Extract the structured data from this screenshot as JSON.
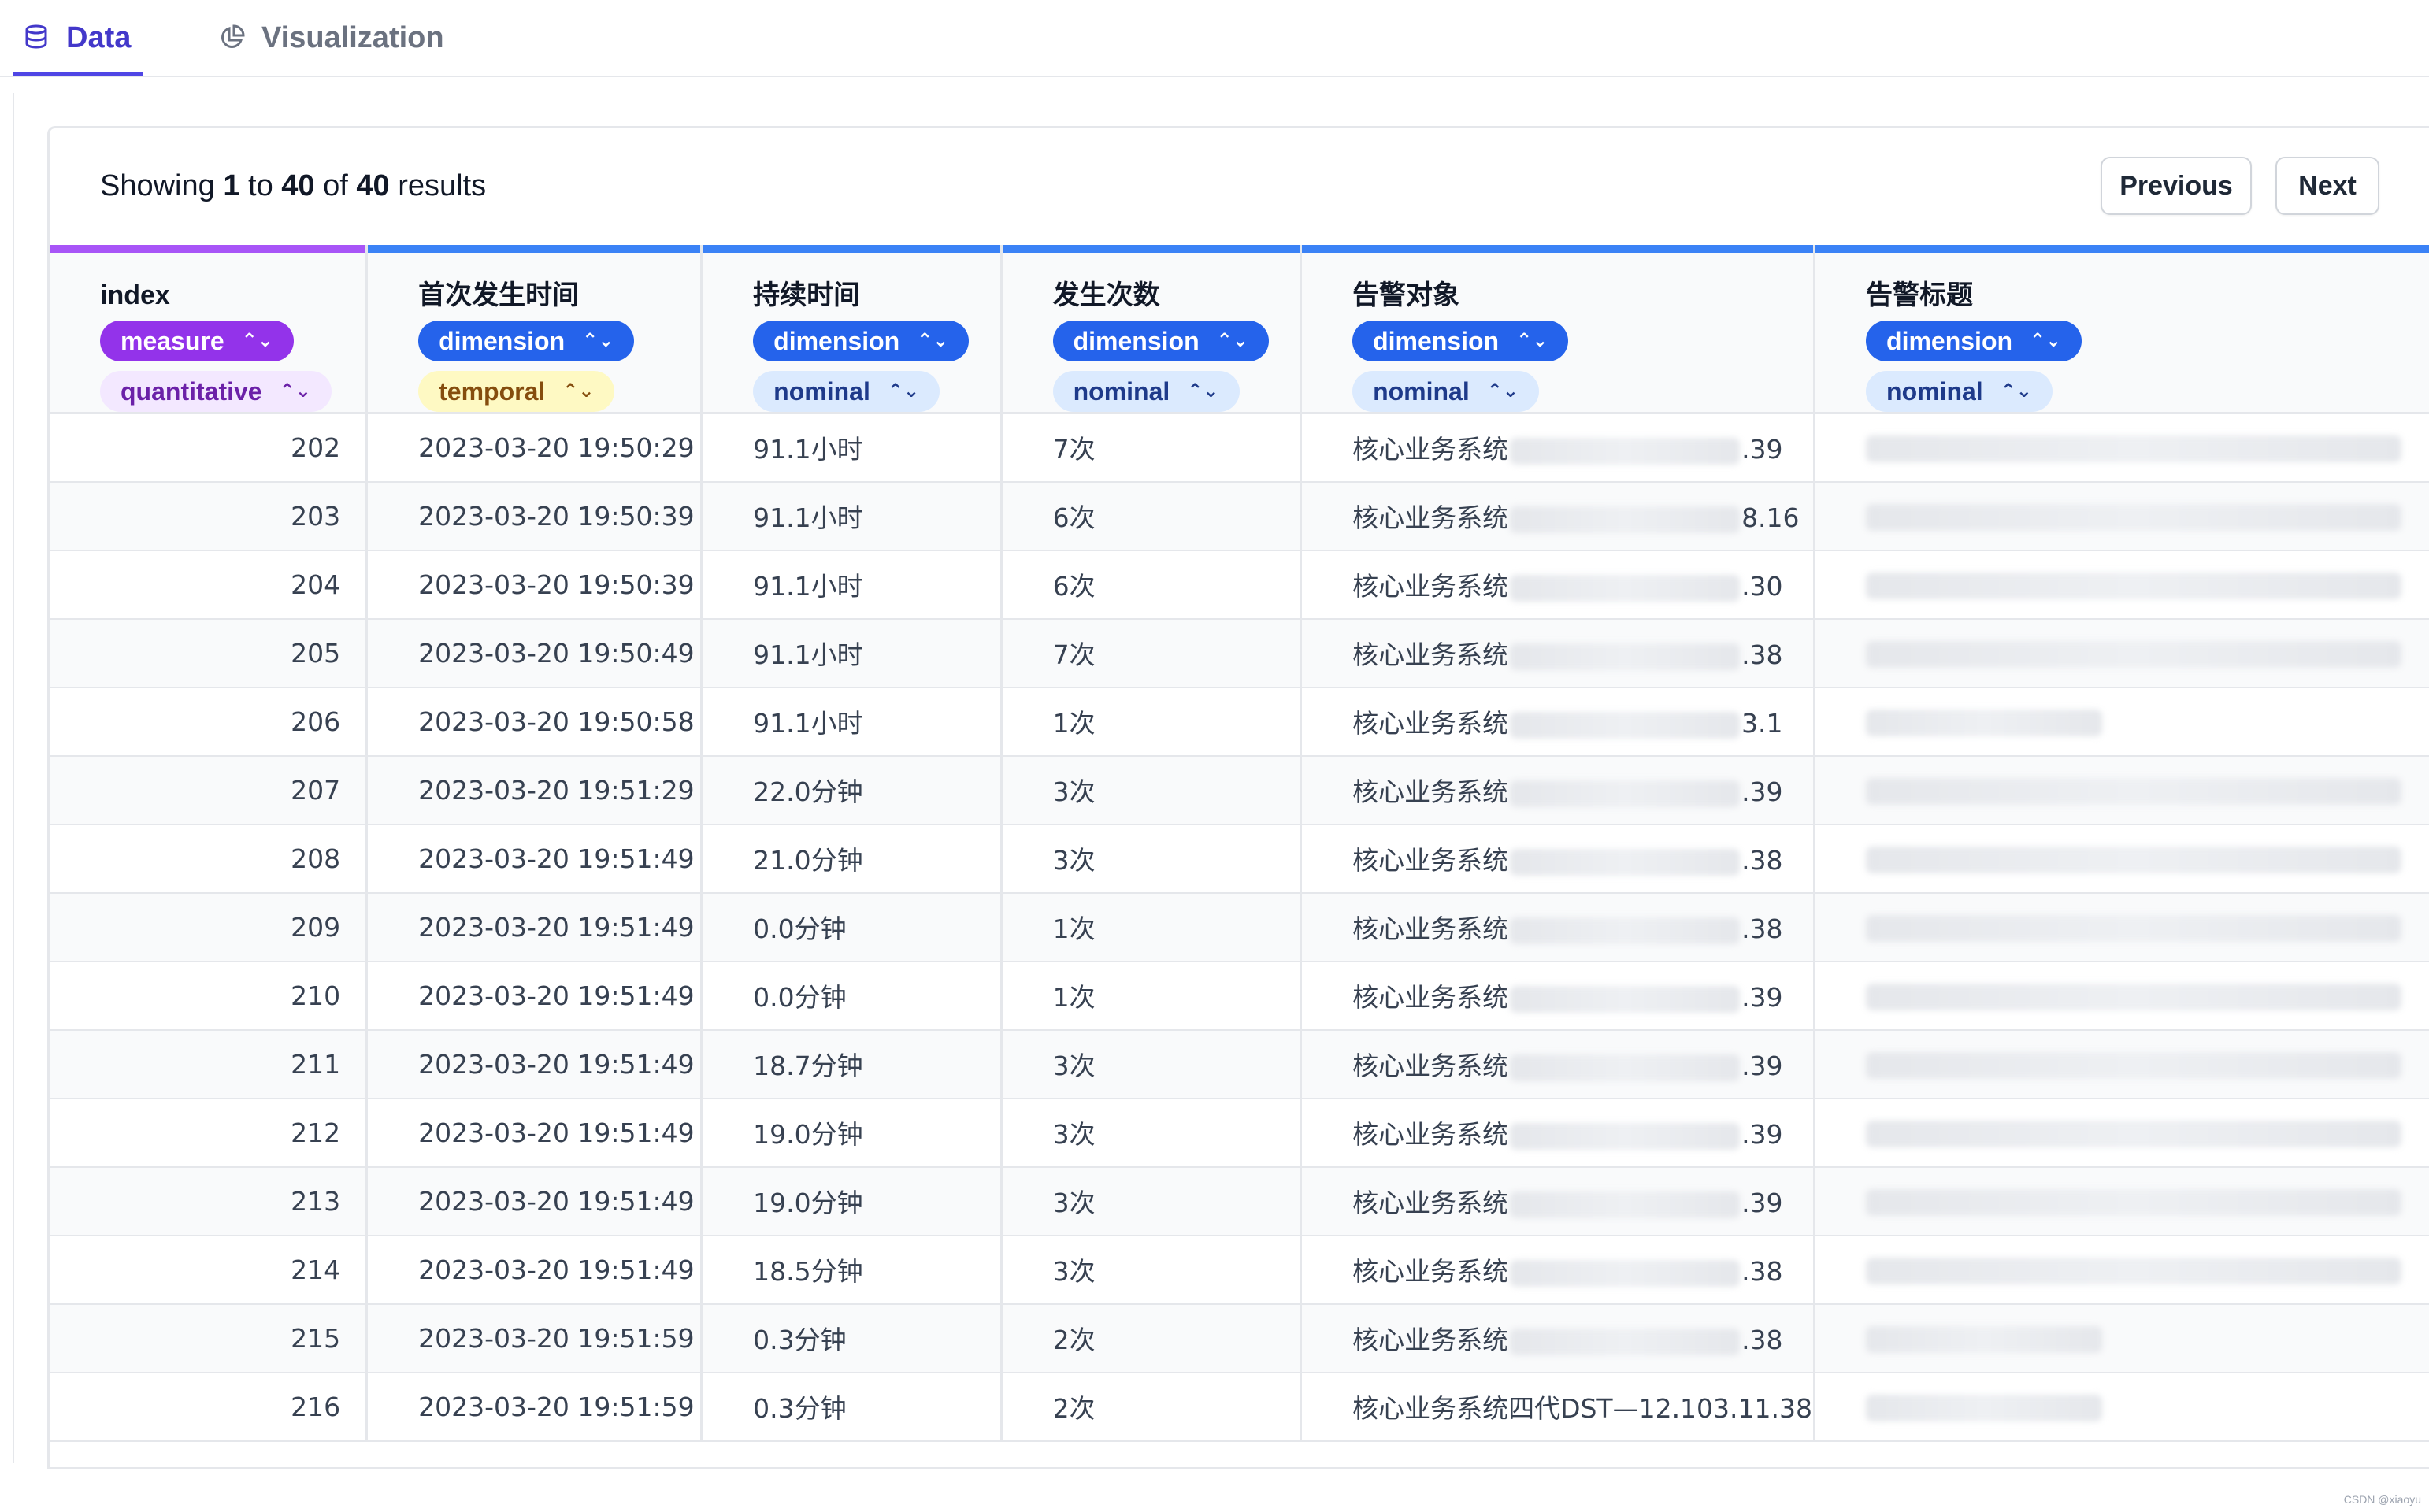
{
  "tabs": [
    {
      "label": "Data",
      "icon": "database-icon",
      "active": true
    },
    {
      "label": "Visualization",
      "icon": "pie-chart-icon",
      "active": false
    }
  ],
  "summary": {
    "prefix": "Showing",
    "from": "1",
    "to_word": "to",
    "to": "40",
    "of_word": "of",
    "total": "40",
    "suffix": "results"
  },
  "pagination": {
    "previous": "Previous",
    "next": "Next"
  },
  "columns": [
    {
      "name": "index",
      "role": "measure",
      "type": "quantitative"
    },
    {
      "name": "首次发生时间",
      "role": "dimension",
      "type": "temporal"
    },
    {
      "name": "持续时间",
      "role": "dimension",
      "type": "nominal"
    },
    {
      "name": "发生次数",
      "role": "dimension",
      "type": "nominal"
    },
    {
      "name": "告警对象",
      "role": "dimension",
      "type": "nominal"
    },
    {
      "name": "告警标题",
      "role": "dimension",
      "type": "nominal"
    }
  ],
  "rows": [
    {
      "index": "202",
      "time": "2023-03-20 19:50:29",
      "duration": "91.1小时",
      "count": "7次",
      "obj_prefix": "核心业务系统",
      "obj_suffix": ".39"
    },
    {
      "index": "203",
      "time": "2023-03-20 19:50:39",
      "duration": "91.1小时",
      "count": "6次",
      "obj_prefix": "核心业务系统",
      "obj_suffix": "8.16"
    },
    {
      "index": "204",
      "time": "2023-03-20 19:50:39",
      "duration": "91.1小时",
      "count": "6次",
      "obj_prefix": "核心业务系统",
      "obj_suffix": ".30"
    },
    {
      "index": "205",
      "time": "2023-03-20 19:50:49",
      "duration": "91.1小时",
      "count": "7次",
      "obj_prefix": "核心业务系统",
      "obj_suffix": ".38"
    },
    {
      "index": "206",
      "time": "2023-03-20 19:50:58",
      "duration": "91.1小时",
      "count": "1次",
      "obj_prefix": "核心业务系统",
      "obj_suffix": "3.1"
    },
    {
      "index": "207",
      "time": "2023-03-20 19:51:29",
      "duration": "22.0分钟",
      "count": "3次",
      "obj_prefix": "核心业务系统",
      "obj_suffix": ".39"
    },
    {
      "index": "208",
      "time": "2023-03-20 19:51:49",
      "duration": "21.0分钟",
      "count": "3次",
      "obj_prefix": "核心业务系统",
      "obj_suffix": ".38"
    },
    {
      "index": "209",
      "time": "2023-03-20 19:51:49",
      "duration": "0.0分钟",
      "count": "1次",
      "obj_prefix": "核心业务系统",
      "obj_suffix": ".38"
    },
    {
      "index": "210",
      "time": "2023-03-20 19:51:49",
      "duration": "0.0分钟",
      "count": "1次",
      "obj_prefix": "核心业务系统",
      "obj_suffix": ".39"
    },
    {
      "index": "211",
      "time": "2023-03-20 19:51:49",
      "duration": "18.7分钟",
      "count": "3次",
      "obj_prefix": "核心业务系统",
      "obj_suffix": ".39"
    },
    {
      "index": "212",
      "time": "2023-03-20 19:51:49",
      "duration": "19.0分钟",
      "count": "3次",
      "obj_prefix": "核心业务系统",
      "obj_suffix": ".39"
    },
    {
      "index": "213",
      "time": "2023-03-20 19:51:49",
      "duration": "19.0分钟",
      "count": "3次",
      "obj_prefix": "核心业务系统",
      "obj_suffix": ".39"
    },
    {
      "index": "214",
      "time": "2023-03-20 19:51:49",
      "duration": "18.5分钟",
      "count": "3次",
      "obj_prefix": "核心业务系统",
      "obj_suffix": ".38"
    },
    {
      "index": "215",
      "time": "2023-03-20 19:51:59",
      "duration": "0.3分钟",
      "count": "2次",
      "obj_prefix": "核心业务系统",
      "obj_suffix": ".38"
    },
    {
      "index": "216",
      "time": "2023-03-20 19:51:59",
      "duration": "0.3分钟",
      "count": "2次",
      "obj_prefix": "核心业务系统四代DST—12.103.11",
      "obj_suffix": ".38"
    }
  ],
  "colors": {
    "accent": "#4f46e5",
    "measure": "#9333ea",
    "dimension": "#2563eb",
    "column_bar": "#3b82f6",
    "index_bar": "#a855f7"
  }
}
